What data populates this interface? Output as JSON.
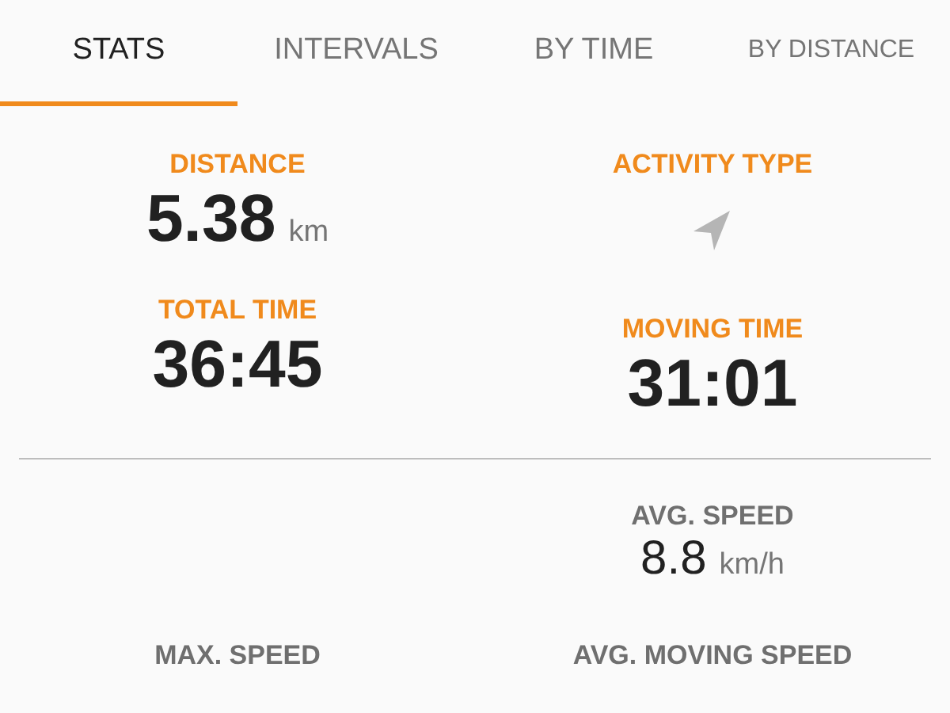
{
  "tabs": [
    {
      "label": "STATS",
      "selected": true
    },
    {
      "label": "INTERVALS",
      "selected": false
    },
    {
      "label": "BY TIME",
      "selected": false
    },
    {
      "label": "BY DISTANCE",
      "selected": false
    }
  ],
  "sections": [
    {
      "highlighted": true,
      "rows": [
        [
          {
            "kind": "value",
            "label": "DISTANCE",
            "value": "5.38",
            "unit": "km"
          },
          {
            "kind": "icon",
            "label": "ACTIVITY TYPE"
          }
        ],
        [
          {
            "kind": "value",
            "label": "TOTAL TIME",
            "value": "36:45"
          },
          {
            "kind": "value",
            "label": "MOVING TIME",
            "value": "31:01"
          }
        ]
      ]
    },
    {
      "highlighted": false,
      "rows": [
        [
          {
            "kind": "empty"
          },
          {
            "kind": "value",
            "label": "AVG. SPEED",
            "value": "8.8",
            "unit": "km/h"
          }
        ],
        [
          {
            "kind": "label",
            "label": "MAX. SPEED"
          },
          {
            "kind": "label",
            "label": "AVG. MOVING SPEED"
          }
        ]
      ]
    }
  ]
}
